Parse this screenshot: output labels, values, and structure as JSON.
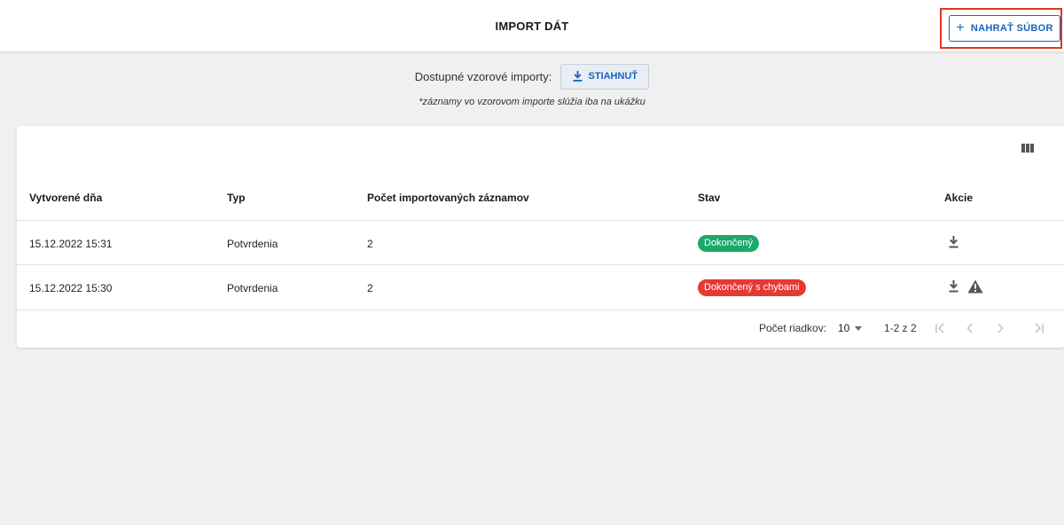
{
  "header": {
    "title": "IMPORT DÁT",
    "upload_label": "NAHRAŤ SÚBOR",
    "upload_icon": "plus-icon"
  },
  "samples": {
    "label": "Dostupné vzorové importy:",
    "download_label": "STIAHNUŤ",
    "download_icon": "download-icon",
    "note": "*záznamy vo vzorovom importe slúžia iba na ukážku"
  },
  "table": {
    "columns_icon": "view-columns-icon",
    "headers": {
      "created": "Vytvorené dňa",
      "type": "Typ",
      "count": "Počet importovaných záznamov",
      "status": "Stav",
      "actions": "Akcie"
    },
    "rows": [
      {
        "created": "15.12.2022 15:31",
        "type": "Potvrdenia",
        "count": "2",
        "status": "Dokončený",
        "status_color": "#1aa86b",
        "actions": [
          "download-icon"
        ]
      },
      {
        "created": "15.12.2022 15:30",
        "type": "Potvrdenia",
        "count": "2",
        "status": "Dokončený s chybami",
        "status_color": "#e53935",
        "actions": [
          "download-icon",
          "warning-icon"
        ]
      }
    ]
  },
  "pagination": {
    "rows_label": "Počet riadkov:",
    "rows_value": "10",
    "range": "1-2 z 2"
  },
  "colors": {
    "accent": "#1565c0",
    "highlight": "#e8341c",
    "success": "#1aa86b",
    "error": "#e53935",
    "background": "#f0f0f0"
  }
}
